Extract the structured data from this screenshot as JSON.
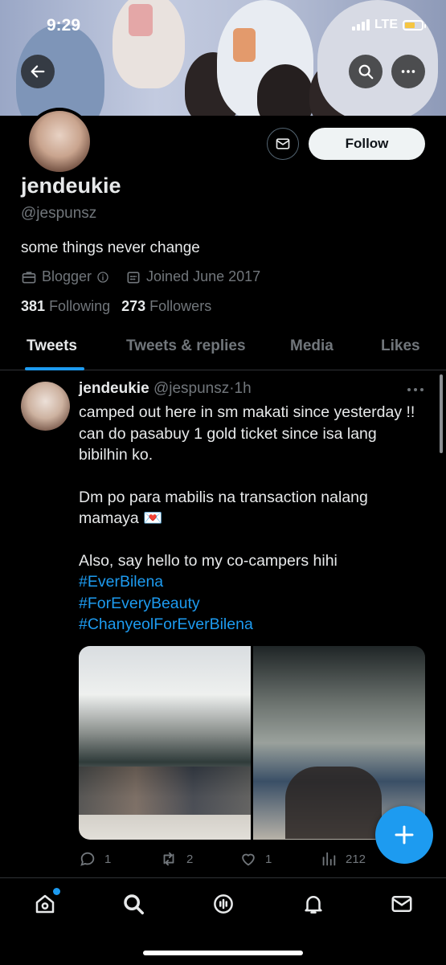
{
  "status_bar": {
    "time": "9:29",
    "network": "LTE"
  },
  "profile": {
    "name": "jendeukie",
    "handle": "@jespunsz",
    "bio": "some things never change",
    "category": "Blogger",
    "joined": "Joined June 2017",
    "following_count": "381",
    "following_label": "Following",
    "followers_count": "273",
    "followers_label": "Followers",
    "follow_label": "Follow"
  },
  "tabs": [
    {
      "label": "Tweets",
      "active": true
    },
    {
      "label": "Tweets & replies",
      "active": false
    },
    {
      "label": "Media",
      "active": false
    },
    {
      "label": "Likes",
      "active": false
    }
  ],
  "tweet": {
    "author_name": "jendeukie",
    "author_handle": "@jespunsz",
    "separator": "·",
    "time": "1h",
    "line1": "camped out here in sm makati since yesterday !! can do pasabuy 1 gold ticket since isa lang bibilhin ko.",
    "line2": "Dm po para mabilis na transaction nalang mamaya 💌",
    "line3": "Also, say hello to my co-campers hihi",
    "hashtags": [
      "#EverBilena",
      "#ForEveryBeauty",
      "#ChanyeolForEverBilena"
    ],
    "replies": "1",
    "retweets": "2",
    "likes": "1",
    "views": "212"
  },
  "colors": {
    "accent": "#1d9bf0",
    "background": "#000000",
    "muted": "#71767b"
  },
  "icons": {
    "back": "arrow-left-icon",
    "search": "search-icon",
    "more": "more-icon",
    "message": "envelope-icon",
    "compose": "plus-icon"
  }
}
